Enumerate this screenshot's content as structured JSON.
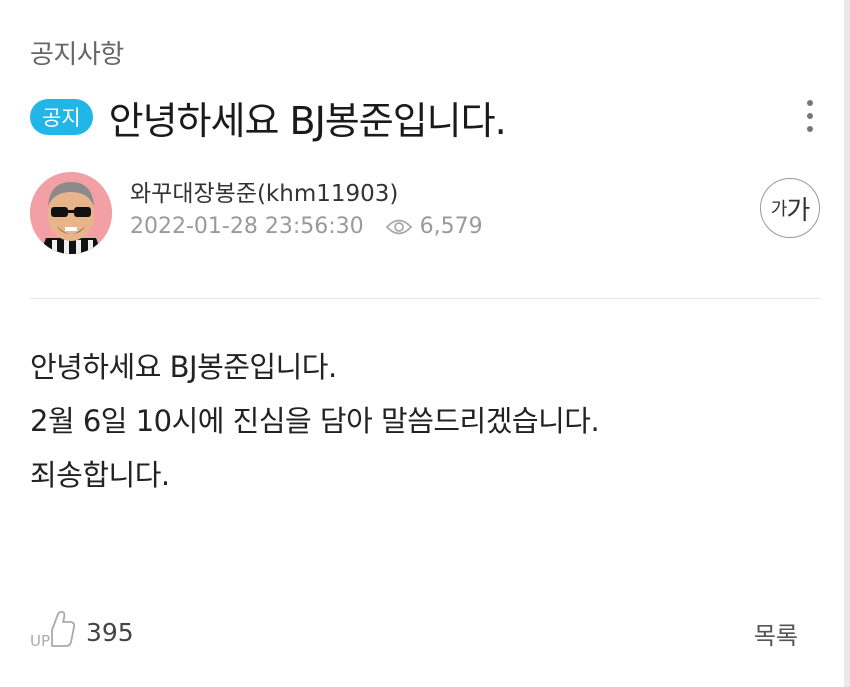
{
  "board": {
    "category": "공지사항"
  },
  "post": {
    "badge": "공지",
    "title": "안녕하세요 BJ봉준입니다.",
    "author": "와꾸대장봉준(khm11903)",
    "datetime": "2022-01-28 23:56:30",
    "views": "6,579",
    "body": [
      "안녕하세요 BJ봉준입니다.",
      "2월 6일 10시에 진심을 담아 말씀드리겠습니다.",
      "죄송합니다."
    ]
  },
  "controls": {
    "font_size_small": "가",
    "font_size_large": "가",
    "like_icon_text": "UP",
    "like_count": "395",
    "list_label": "목록"
  },
  "colors": {
    "badge": "#22b5e8",
    "avatar_bg": "#f2a0a6",
    "muted": "#9a9a9a"
  },
  "icons": [
    "more-vertical-icon",
    "eye-icon",
    "thumbs-up-icon"
  ]
}
